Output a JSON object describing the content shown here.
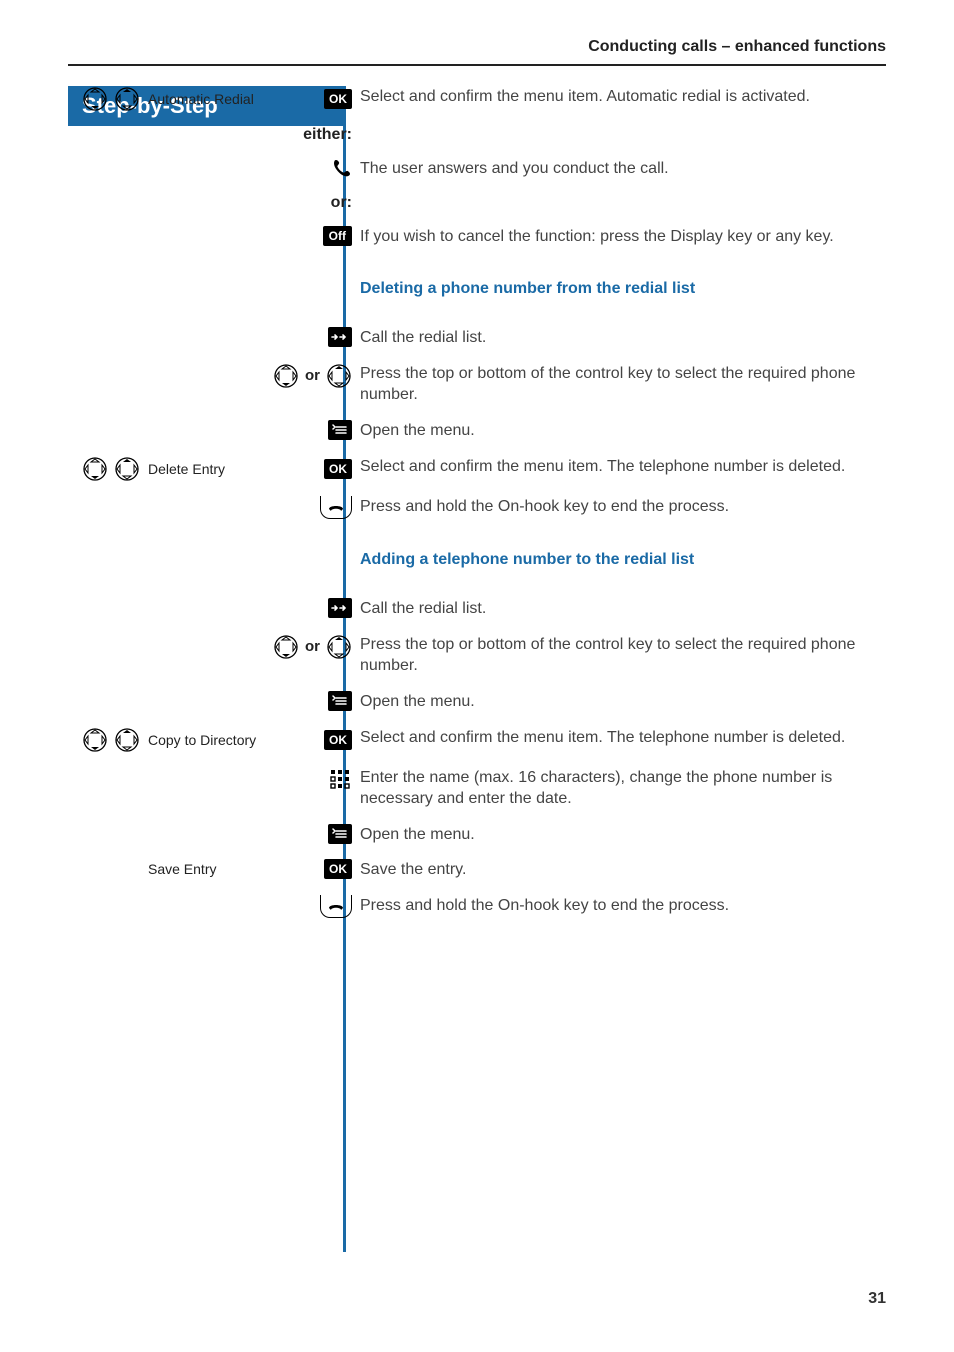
{
  "header": {
    "running": "Conducting calls – enhanced functions"
  },
  "side": {
    "title": "Step-by-Step"
  },
  "labels": {
    "ok": "OK",
    "off": "Off",
    "either": "either:",
    "or": "or:",
    "or_small": "or"
  },
  "rows": {
    "auto_redial_label": "Automatic Redial",
    "auto_redial_desc": "Select and confirm the menu item. Automatic redial is activated.",
    "either_answer": "The user answers and you conduct the call.",
    "off_desc": "If you wish to cancel the function: press the Display key or any key.",
    "sub_delete": "Deleting a phone number from the redial list",
    "call_redial": "Call the redial list.",
    "press_topbottom": "Press the top or bottom of the control key to select the required phone number.",
    "open_menu": "Open the menu.",
    "delete_entry_label": "Delete Entry",
    "delete_entry_desc": "Select and confirm the menu item. The telephone number is deleted.",
    "hold_onhook": "Press and hold the On-hook key to end the process.",
    "sub_add": "Adding a telephone number to the redial list",
    "copy_dir_label": "Copy to Directory",
    "copy_dir_desc": "Select and confirm the menu item. The telephone number is deleted.",
    "enter_name": "Enter the name (max. 16 characters), change the phone number is necessary and enter the date.",
    "save_entry_label": "Save Entry",
    "save_entry_desc": "Save the entry."
  },
  "page_number": "31"
}
